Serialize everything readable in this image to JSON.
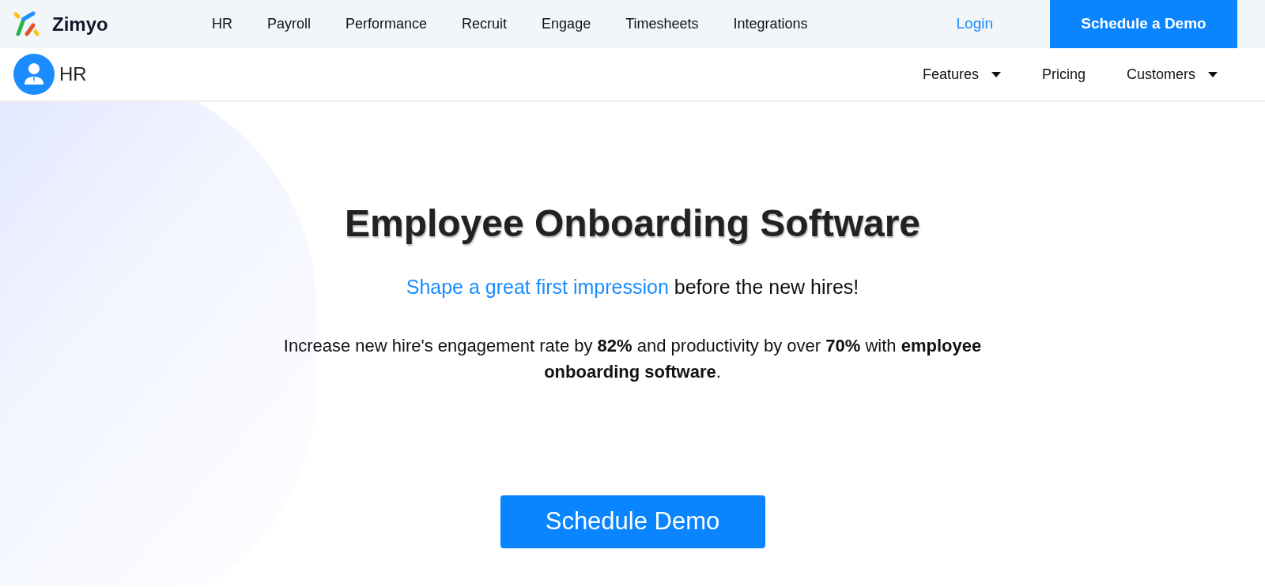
{
  "top_nav": {
    "brand": "Zimyo",
    "links": [
      {
        "label": "HR"
      },
      {
        "label": "Payroll"
      },
      {
        "label": "Performance"
      },
      {
        "label": "Recruit"
      },
      {
        "label": "Engage"
      },
      {
        "label": "Timesheets"
      },
      {
        "label": "Integrations"
      }
    ],
    "login": "Login",
    "cta": "Schedule a Demo"
  },
  "sub_nav": {
    "title": "HR",
    "links": [
      {
        "label": "Features",
        "kind": "dropdown"
      },
      {
        "label": "Pricing",
        "kind": "link"
      },
      {
        "label": "Customers",
        "kind": "dropdown"
      }
    ]
  },
  "hero": {
    "heading": "Employee Onboarding Software",
    "tagline_highlight": "Shape a great first impression",
    "tagline_rest": "before the new hires!",
    "description": "Increase new hire's engagement rate by **82%** and productivity by over **70%** with **employee onboarding software**.",
    "button": "Schedule Demo"
  }
}
